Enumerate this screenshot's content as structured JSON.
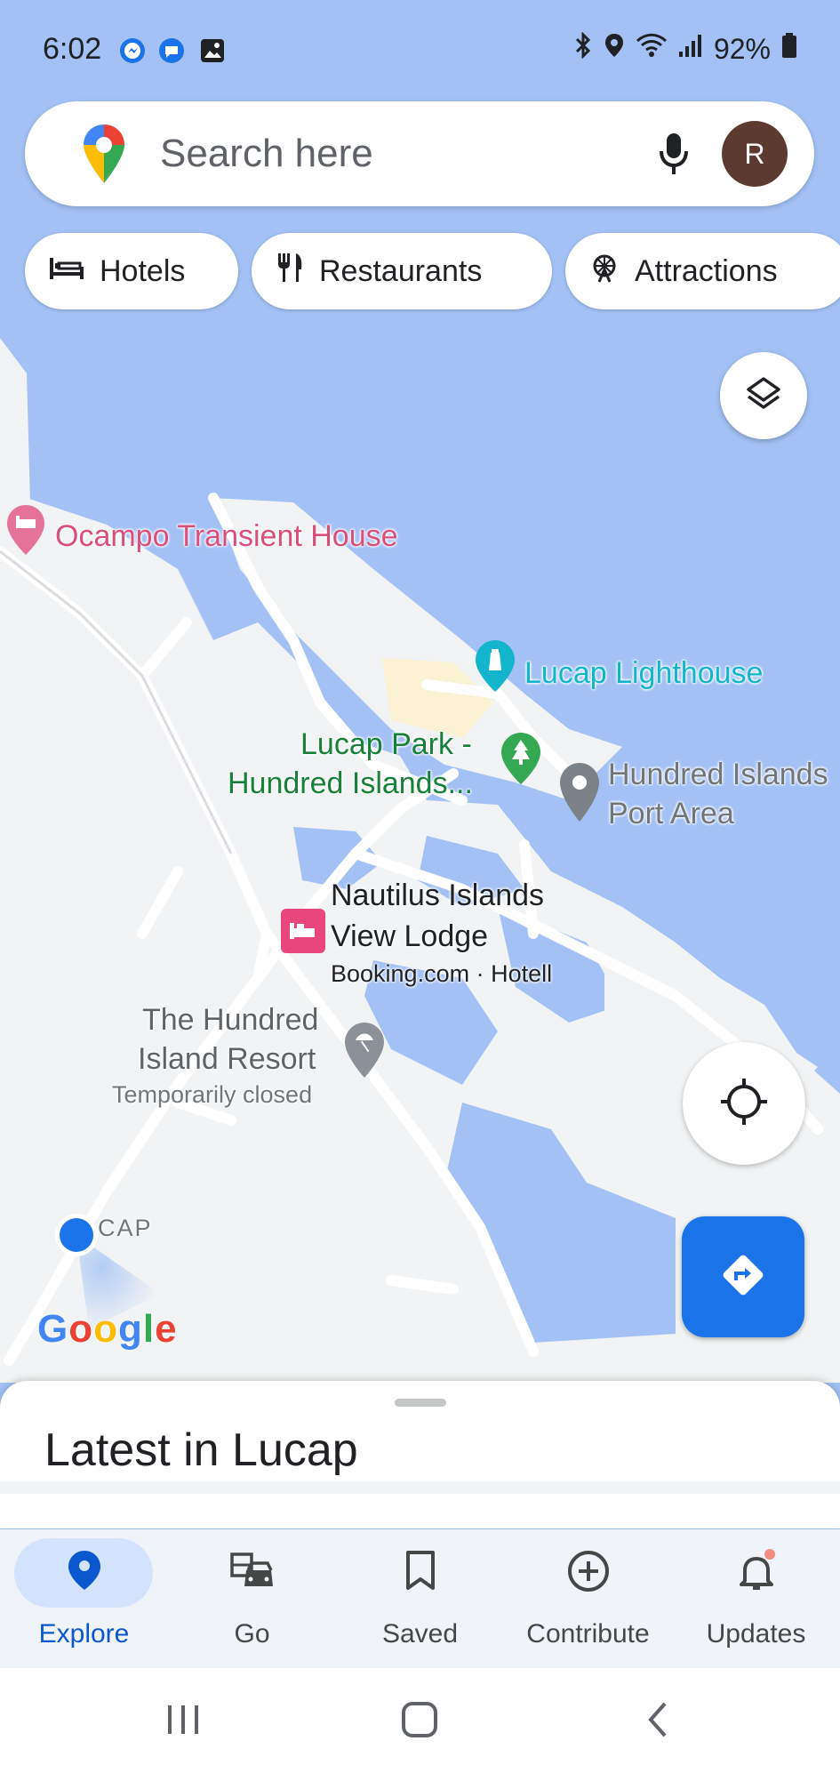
{
  "status_bar": {
    "time": "6:02",
    "battery": "92%",
    "left_icons": [
      "messenger-icon",
      "chat-bubble-icon",
      "gallery-icon"
    ],
    "right_icons": [
      "bluetooth-icon",
      "location-icon",
      "wifi-icon",
      "signal-icon",
      "battery-icon"
    ]
  },
  "search": {
    "placeholder": "Search here",
    "avatar_letter": "R",
    "avatar_color": "#5d3a2f"
  },
  "chips": [
    {
      "label": "Hotels",
      "icon": "bed-icon"
    },
    {
      "label": "Restaurants",
      "icon": "fork-knife-icon"
    },
    {
      "label": "Attractions",
      "icon": "ferris-wheel-icon"
    }
  ],
  "map": {
    "places": [
      {
        "name": "Ocampo Transient House",
        "color": "#d94f7a",
        "icon": "lodging-pin-icon"
      },
      {
        "name": "Lucap Lighthouse",
        "color": "#12b5cb",
        "icon": "lighthouse-pin-icon"
      },
      {
        "name_line1": "Lucap Park -",
        "name_line2": "Hundred Islands...",
        "color": "#188038",
        "icon": "park-pin-icon"
      },
      {
        "name_line1": "Hundred Islands",
        "name_line2": "Port Area",
        "color": "#70757a",
        "icon": "place-pin-icon"
      },
      {
        "name_line1": "Nautilus Islands",
        "name_line2": "View Lodge",
        "sub": "Booking.com · Hotell",
        "color": "#e8467c",
        "icon": "hotel-marker-icon"
      },
      {
        "name_line1": "The Hundred",
        "name_line2": "Island Resort",
        "sub": "Temporarily closed",
        "color": "#70757a",
        "icon": "beach-pin-icon"
      }
    ],
    "area_label": "CAP",
    "water_color": "#a3c1f5",
    "land_color": "#f1f3f4",
    "google_logo": "Google"
  },
  "sheet": {
    "title": "Latest in Lucap"
  },
  "bottom_nav": [
    {
      "label": "Explore",
      "icon": "explore-pin-icon",
      "active": true
    },
    {
      "label": "Go",
      "icon": "commute-icon",
      "active": false
    },
    {
      "label": "Saved",
      "icon": "bookmark-icon",
      "active": false
    },
    {
      "label": "Contribute",
      "icon": "add-circle-icon",
      "active": false
    },
    {
      "label": "Updates",
      "icon": "bell-icon",
      "active": false
    }
  ],
  "system_nav": [
    "recents-icon",
    "home-icon",
    "back-icon"
  ],
  "accent_color": "#1a73e8"
}
